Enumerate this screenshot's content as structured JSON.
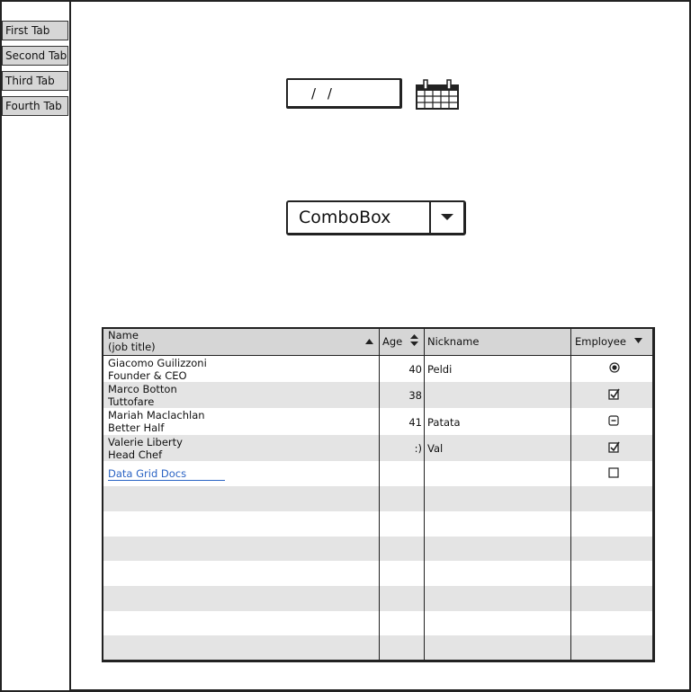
{
  "tabs": [
    "First Tab",
    "Second Tab",
    "Third Tab",
    "Fourth Tab"
  ],
  "date_field": {
    "value": "/ /"
  },
  "icons": {
    "calendar": "calendar-icon",
    "dropdown": "chevron-down-icon"
  },
  "combobox": {
    "value": "ComboBox"
  },
  "grid": {
    "columns": {
      "name_line1": "Name",
      "name_line2": "(job title)",
      "age": "Age",
      "nickname": "Nickname",
      "employee": "Employee"
    },
    "sort": {
      "name": "ascending",
      "age": "sortable",
      "employee": "descending"
    },
    "rows": [
      {
        "name": "Giacomo Guilizzoni",
        "title": "Founder & CEO",
        "age": "40",
        "nickname": "Peldi",
        "employee": "radio-selected"
      },
      {
        "name": "Marco Botton",
        "title": "Tuttofare",
        "age": "38",
        "nickname": "",
        "employee": "checked"
      },
      {
        "name": "Mariah Maclachlan",
        "title": "Better Half",
        "age": "41",
        "nickname": "Patata",
        "employee": "indeterminate"
      },
      {
        "name": "Valerie Liberty",
        "title": "Head Chef",
        "age": ":)",
        "nickname": "Val",
        "employee": "checked"
      }
    ],
    "link_row": {
      "label": "Data Grid Docs",
      "employee": "unchecked"
    }
  }
}
